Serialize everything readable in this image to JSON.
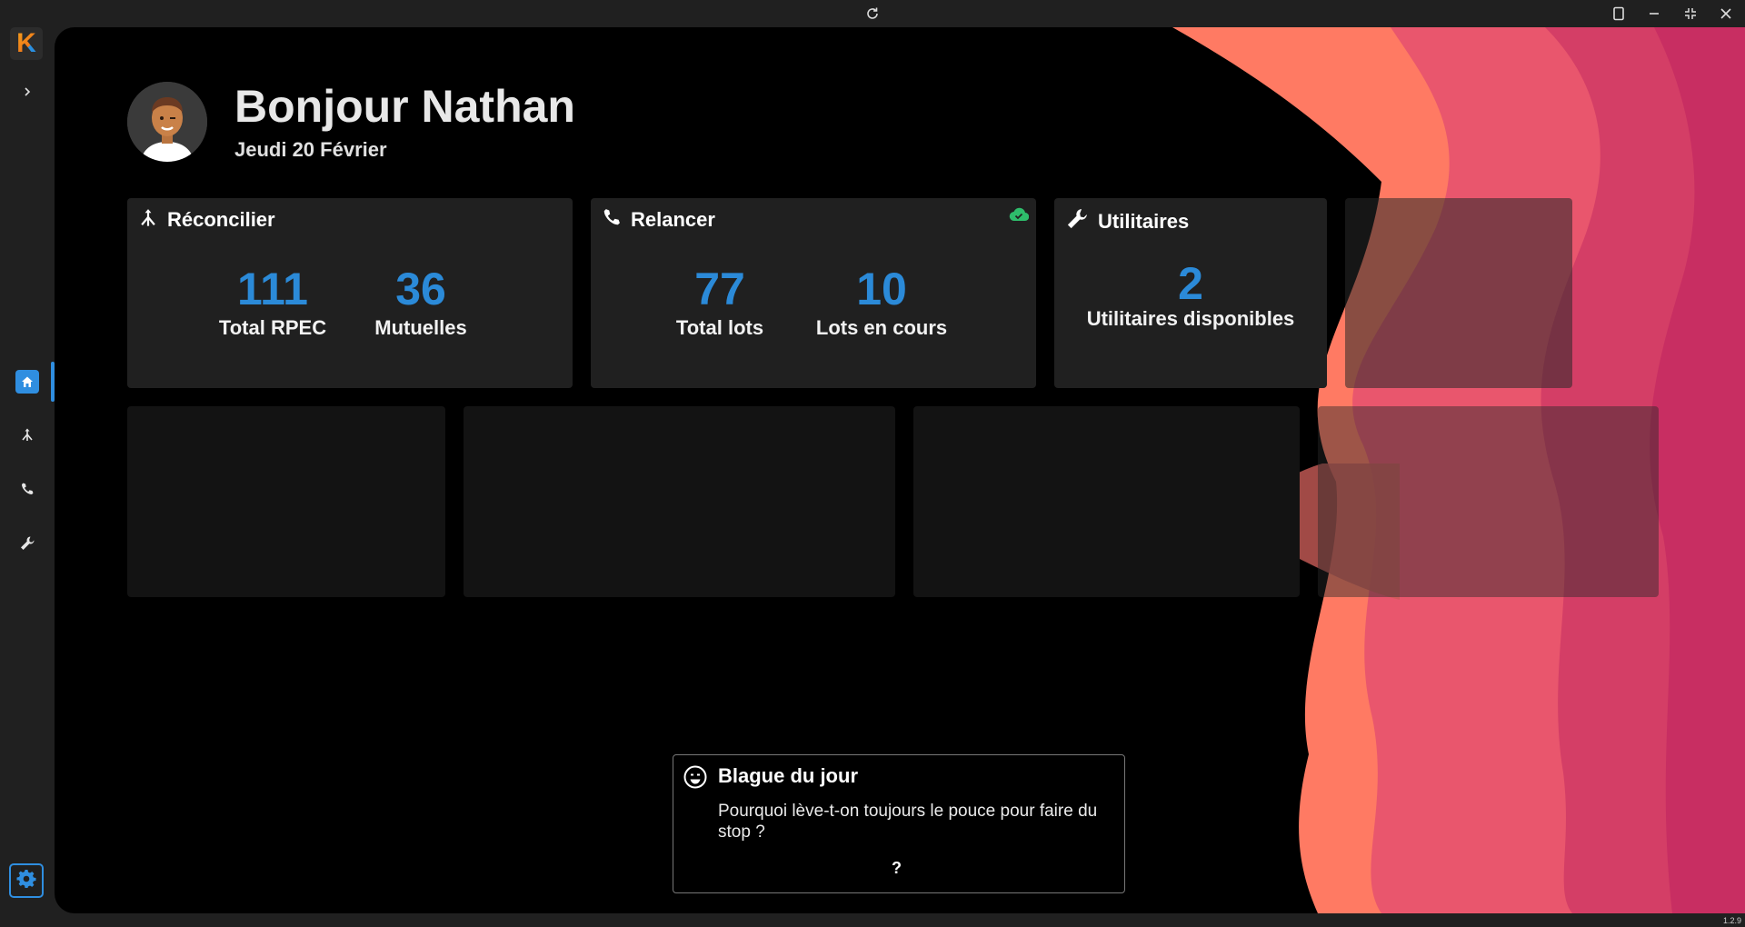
{
  "app": {
    "version": "1.2.9"
  },
  "colors": {
    "accent": "#2f8ee0",
    "number": "#2b8ad8",
    "cloud_status": "#2ebd6b"
  },
  "header": {
    "greeting": "Bonjour Nathan",
    "date": "Jeudi 20 Février"
  },
  "sidebar": {
    "items": [
      {
        "name": "home",
        "icon": "home-icon",
        "active": true
      },
      {
        "name": "reconcilier",
        "icon": "merge-icon",
        "active": false
      },
      {
        "name": "relancer",
        "icon": "phone-icon",
        "active": false
      },
      {
        "name": "utilitaires",
        "icon": "wrench-icon",
        "active": false
      }
    ],
    "settings_icon": "gear-icon"
  },
  "cards": {
    "reconcilier": {
      "title": "Réconcilier",
      "icon": "merge-icon",
      "stats": [
        {
          "value": "111",
          "label": "Total RPEC"
        },
        {
          "value": "36",
          "label": "Mutuelles"
        }
      ]
    },
    "relancer": {
      "title": "Relancer",
      "icon": "phone-icon",
      "status_icon": "cloud-check-icon",
      "stats": [
        {
          "value": "77",
          "label": "Total lots"
        },
        {
          "value": "10",
          "label": "Lots en cours"
        }
      ]
    },
    "utilitaires": {
      "title": "Utilitaires",
      "icon": "wrench-icon",
      "stats": [
        {
          "value": "2",
          "label": "Utilitaires disponibles"
        }
      ]
    }
  },
  "joke": {
    "title": "Blague du jour",
    "icon": "smile-icon",
    "text": "Pourquoi lève-t-on toujours le pouce pour faire du stop ?",
    "reveal": "?"
  }
}
